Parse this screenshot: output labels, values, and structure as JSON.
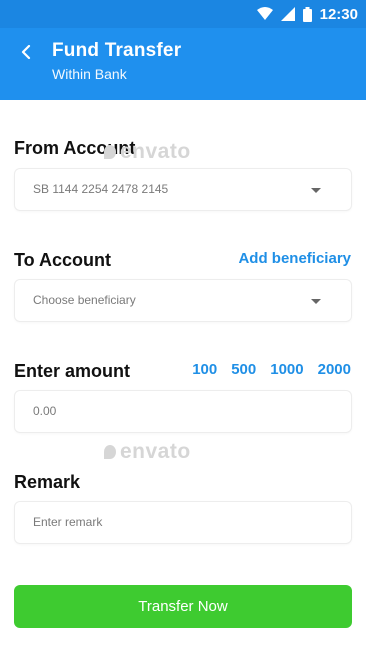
{
  "status_bar": {
    "time": "12:30",
    "icons": [
      "wifi-icon",
      "signal-icon",
      "battery-icon"
    ]
  },
  "header": {
    "title": "Fund Transfer",
    "subtitle": "Within Bank",
    "back_icon": "back-arrow-icon"
  },
  "from_account": {
    "label": "From Account",
    "value": "SB 1144 2254 2478 2145"
  },
  "to_account": {
    "label": "To Account",
    "add_link": "Add beneficiary",
    "placeholder": "Choose beneficiary"
  },
  "amount": {
    "label": "Enter amount",
    "quick_amounts": [
      "100",
      "500",
      "1000",
      "2000"
    ],
    "placeholder": "0.00"
  },
  "remark": {
    "label": "Remark",
    "placeholder": "Enter remark"
  },
  "submit": {
    "label": "Transfer Now"
  },
  "watermark": {
    "text": "envato"
  },
  "colors": {
    "primary": "#1f90ee",
    "status": "#1b86e2",
    "link": "#1f8fe6",
    "button": "#3ecb30"
  }
}
